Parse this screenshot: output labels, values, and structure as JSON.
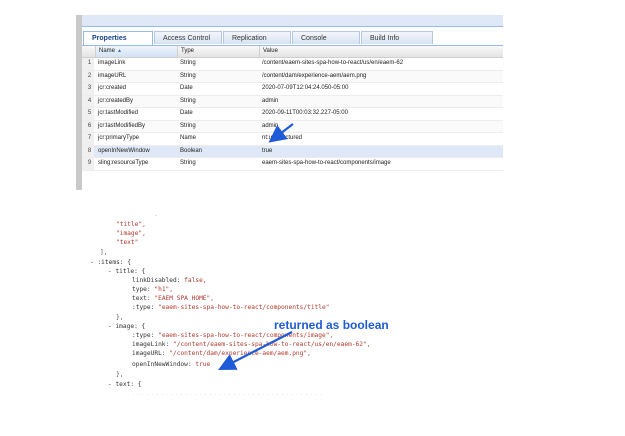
{
  "tabs": [
    "Properties",
    "Access Control",
    "Replication",
    "Console",
    "Build Info"
  ],
  "grid": {
    "headers": {
      "name": "Name",
      "type": "Type",
      "value": "Value"
    },
    "rows": [
      {
        "num": "1",
        "name": "imageLink",
        "type": "String",
        "value": "/content/eaem-sites-spa-how-to-react/us/en/eaem-62"
      },
      {
        "num": "2",
        "name": "imageURL",
        "type": "String",
        "value": "/content/dam/experience-aem/aem.png"
      },
      {
        "num": "3",
        "name": "jcr:created",
        "type": "Date",
        "value": "2020-07-09T12:04:24.050-05:00"
      },
      {
        "num": "4",
        "name": "jcr:createdBy",
        "type": "String",
        "value": "admin"
      },
      {
        "num": "5",
        "name": "jcr:lastModified",
        "type": "Date",
        "value": "2020-09-11T00:03:32.227-05:00"
      },
      {
        "num": "6",
        "name": "jcr:lastModifiedBy",
        "type": "String",
        "value": "admin"
      },
      {
        "num": "7",
        "name": "jcr:primaryType",
        "type": "Name",
        "value": "nt:unstructured"
      },
      {
        "num": "8",
        "name": "openInNewWindow",
        "type": "Boolean",
        "value": "true"
      },
      {
        "num": "9",
        "name": "sling:resourceType",
        "type": "String",
        "value": "eaem-sites-spa-how-to-react/components/image"
      }
    ]
  },
  "code": {
    "l_title": "\"title\",",
    "l_image": "\"image\",",
    "l_text": "\"text\"",
    "l_close_arr": "],",
    "l_items": "- :items: {",
    "l_title_obj": "- title: {",
    "l_linkDisabled_k": "linkDisabled:",
    "l_linkDisabled_v": "false,",
    "l_type_k": "type:",
    "l_type_v": "\"h1\",",
    "l_text_k": "text:",
    "l_text_v": "\"EAEM SPA HOME\",",
    "l_ctype_k": ":type:",
    "l_ctype_v": "\"eaem-sites-spa-how-to-react/components/title\"",
    "l_close_obj": "},",
    "l_image_obj": "- image: {",
    "l_itype_k": ":type:",
    "l_itype_v": "\"eaem-sites-spa-how-to-react/components/image\",",
    "l_ilink_k": "imageLink:",
    "l_ilink_v": "\"/content/eaem-sites-spa-how-to-react/us/en/eaem-62\",",
    "l_iurl_k": "imageURL:",
    "l_iurl_v": "\"/content/dam/experience-aem/aem.png\",",
    "l_open_k": "openInNewWindow:",
    "l_open_v": "true",
    "l_close_obj2": "},",
    "l_text_obj": "- text: {"
  },
  "callout": "returned as boolean",
  "colors": {
    "tab_active": "#15428b",
    "selected_row": "#dfe8f6",
    "callout": "#1f5bd6"
  }
}
